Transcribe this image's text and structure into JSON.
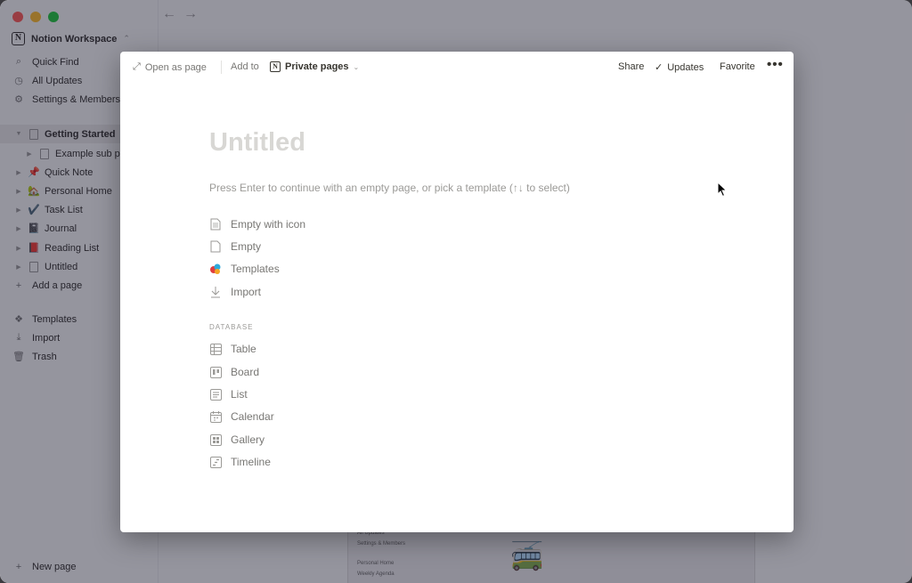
{
  "workspace": {
    "name": "Notion Workspace"
  },
  "sidebar": {
    "top_items": [
      {
        "label": "Quick Find",
        "icon": "search-icon"
      },
      {
        "label": "All Updates",
        "icon": "clock-icon"
      },
      {
        "label": "Settings & Members",
        "icon": "gear-icon"
      }
    ],
    "pages": [
      {
        "label": "Getting Started",
        "icon": "page-icon",
        "active": true
      },
      {
        "label": "Example sub page",
        "icon": "page-icon",
        "sub": true
      },
      {
        "label": "Quick Note",
        "icon": "pin-icon",
        "emoji": "📌"
      },
      {
        "label": "Personal Home",
        "icon": "house-icon",
        "emoji": "🏡"
      },
      {
        "label": "Task List",
        "icon": "check-icon",
        "emoji": "✔️"
      },
      {
        "label": "Journal",
        "icon": "notebook-icon",
        "emoji": "📓"
      },
      {
        "label": "Reading List",
        "icon": "book-icon",
        "emoji": "📕"
      },
      {
        "label": "Untitled",
        "icon": "page-icon"
      }
    ],
    "add_page": "Add a page",
    "bottom_items": [
      {
        "label": "Templates",
        "icon": "templates-icon"
      },
      {
        "label": "Import",
        "icon": "import-icon"
      },
      {
        "label": "Trash",
        "icon": "trash-icon"
      }
    ],
    "new_page": "New page"
  },
  "modal": {
    "open_as_page": "Open as page",
    "add_to": "Add to",
    "location": "Private pages",
    "share": "Share",
    "updates": "Updates",
    "favorite": "Favorite",
    "more": "•••",
    "title_placeholder": "Untitled",
    "hint": "Press Enter to continue with an empty page, or pick a template (↑↓ to select)",
    "options": [
      {
        "label": "Empty with icon",
        "icon": "page-with-icon-icon"
      },
      {
        "label": "Empty",
        "icon": "page-icon"
      },
      {
        "label": "Templates",
        "icon": "templates-icon"
      },
      {
        "label": "Import",
        "icon": "import-icon"
      }
    ],
    "database_heading": "DATABASE",
    "database_options": [
      {
        "label": "Table",
        "icon": "table-icon"
      },
      {
        "label": "Board",
        "icon": "board-icon"
      },
      {
        "label": "List",
        "icon": "list-icon"
      },
      {
        "label": "Calendar",
        "icon": "calendar-icon"
      },
      {
        "label": "Gallery",
        "icon": "gallery-icon"
      },
      {
        "label": "Timeline",
        "icon": "timeline-icon"
      }
    ]
  },
  "background_page": {
    "items": [
      "All Updates",
      "Settings & Members",
      "Personal Home",
      "Weekly Agenda"
    ]
  },
  "colors": {
    "dim_overlay": "#0f0f28",
    "text": "#37352f",
    "muted": "#9b9a97"
  }
}
